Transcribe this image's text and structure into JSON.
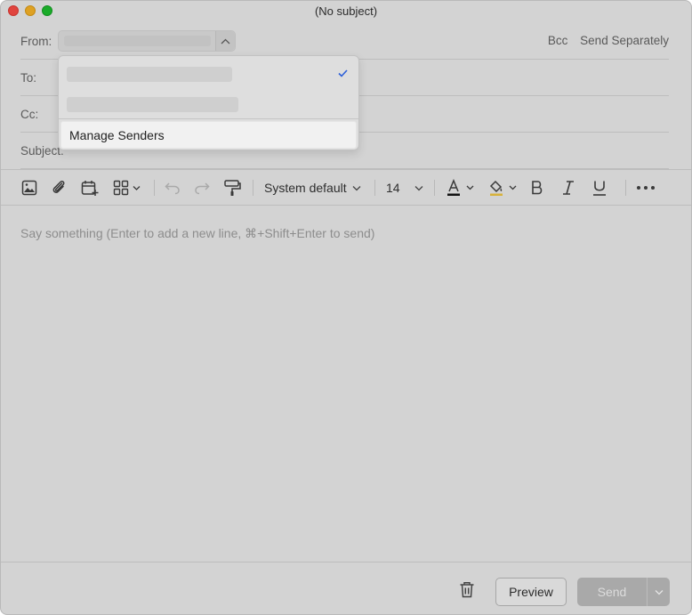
{
  "window": {
    "title": "(No subject)"
  },
  "header": {
    "from_label": "From:",
    "to_label": "To:",
    "cc_label": "Cc:",
    "subject_label": "Subject:",
    "bcc": "Bcc",
    "send_separately": "Send Separately"
  },
  "from_dropdown": {
    "manage_senders": "Manage Senders"
  },
  "toolbar": {
    "font_name": "System default",
    "font_size": "14"
  },
  "editor": {
    "placeholder": "Say something (Enter to add a new line, ⌘+Shift+Enter to send)"
  },
  "footer": {
    "preview": "Preview",
    "send": "Send"
  },
  "colors": {
    "accent_check": "#2b5fd9",
    "font_color_underline": "#111111",
    "highlight_color_underline": "#d7b23a"
  }
}
